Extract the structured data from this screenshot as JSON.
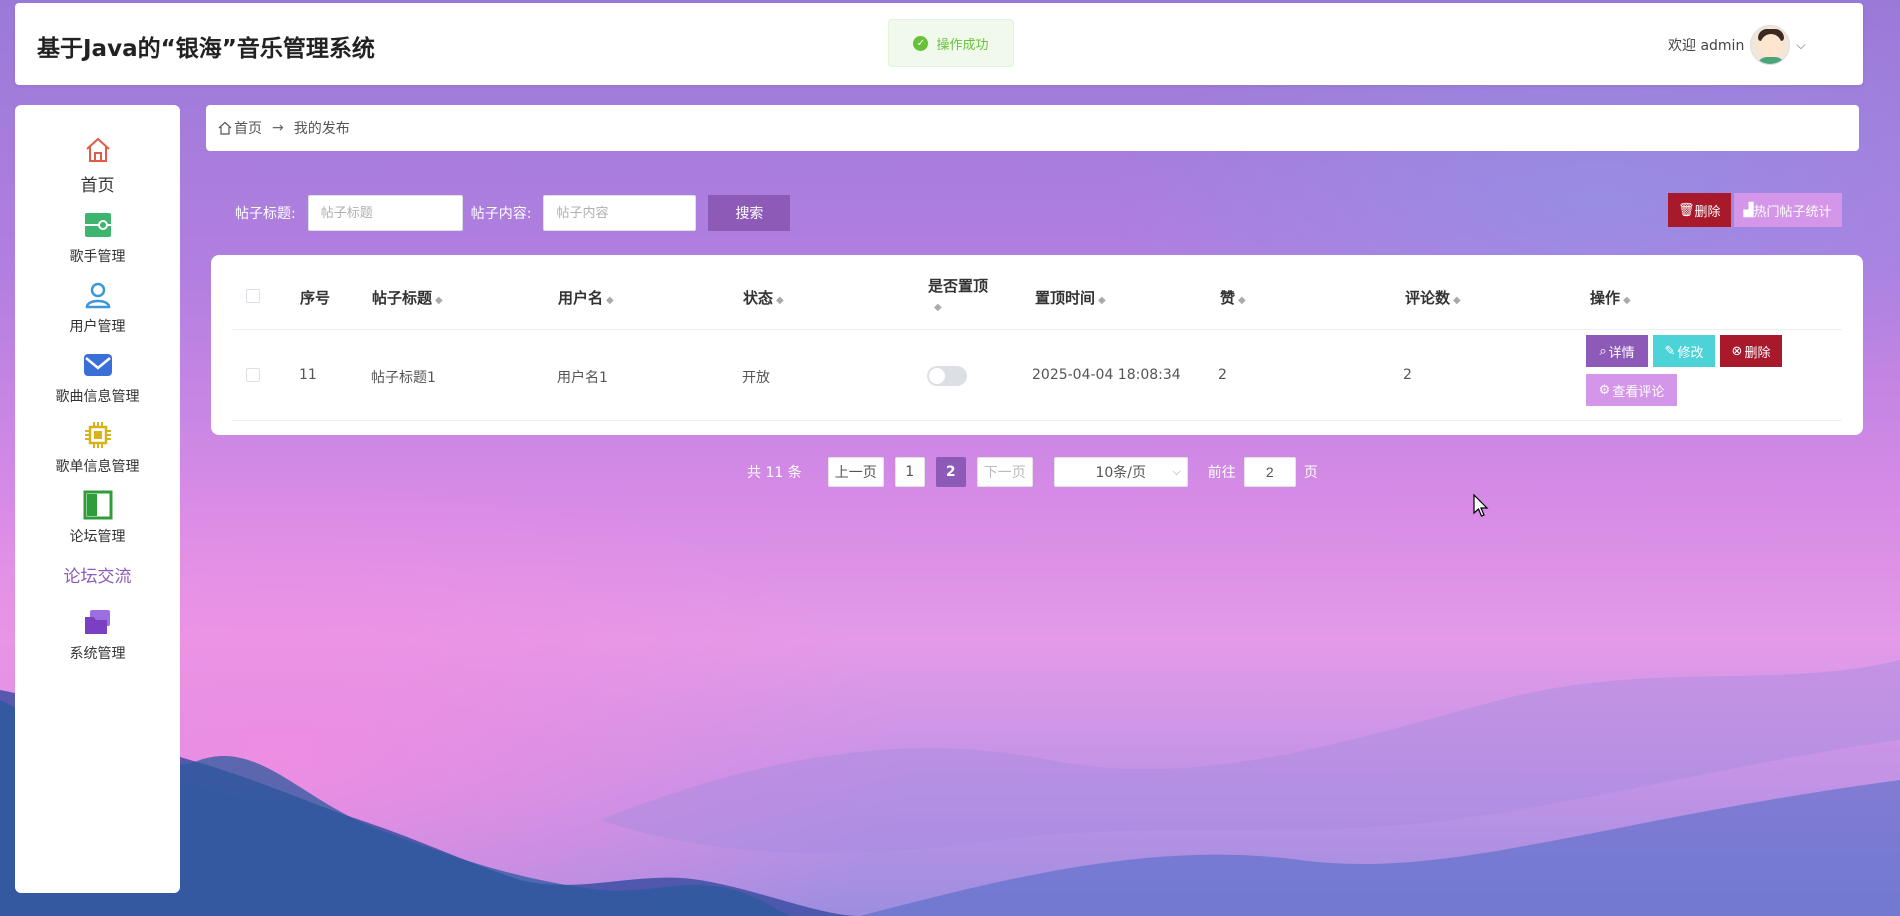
{
  "app": {
    "title": "基于Java的“银海”音乐管理系统"
  },
  "toast": {
    "message": "操作成功",
    "color": "#67c23a"
  },
  "user": {
    "welcome": "欢迎 admin"
  },
  "sidebar": {
    "items": [
      {
        "label": "首页",
        "icon": "home-icon",
        "color": "#e25b45"
      },
      {
        "label": "歌手管理",
        "icon": "toggle-icon",
        "color": "#3db56e"
      },
      {
        "label": "用户管理",
        "icon": "user-icon",
        "color": "#3b97d8"
      },
      {
        "label": "歌曲信息管理",
        "icon": "mail-icon",
        "color": "#3b6fd8"
      },
      {
        "label": "歌单信息管理",
        "icon": "chip-icon",
        "color": "#d8b21b"
      },
      {
        "label": "论坛管理",
        "icon": "book-icon",
        "color": "#2f9e3a"
      },
      {
        "label": "论坛交流",
        "icon": "",
        "color": "#8e5ab8"
      },
      {
        "label": "系统管理",
        "icon": "folder-icon",
        "color": "#7b3fc4"
      }
    ]
  },
  "breadcrumb": {
    "home": "首页",
    "current": "我的发布"
  },
  "search": {
    "title_label": "帖子标题:",
    "title_placeholder": "帖子标题",
    "content_label": "帖子内容:",
    "content_placeholder": "帖子内容",
    "button": "搜索"
  },
  "actions": {
    "batch_delete": "删除",
    "hot_stats": "热门帖子统计"
  },
  "table": {
    "columns": [
      "序号",
      "帖子标题",
      "用户名",
      "状态",
      "是否置顶",
      "置顶时间",
      "赞",
      "评论数",
      "操作"
    ],
    "rows": [
      {
        "id": "11",
        "title": "帖子标题1",
        "username": "用户名1",
        "status": "开放",
        "pinned": false,
        "pin_time": "2025-04-04 18:08:34",
        "likes": "2",
        "comments": "2"
      }
    ],
    "row_actions": {
      "detail": "详情",
      "edit": "修改",
      "delete": "删除",
      "view_comments": "查看评论"
    }
  },
  "pagination": {
    "total": "共 11 条",
    "prev": "上一页",
    "pages": [
      "1",
      "2"
    ],
    "current": "2",
    "next": "下一页",
    "page_size": "10条/页",
    "goto_label": "前往",
    "goto_value": "2",
    "page_suffix": "页"
  },
  "theme": {
    "primary": "#8e5ab8",
    "danger": "#a9192c",
    "info": "#4cd3d8",
    "accent": "#d396e8"
  }
}
